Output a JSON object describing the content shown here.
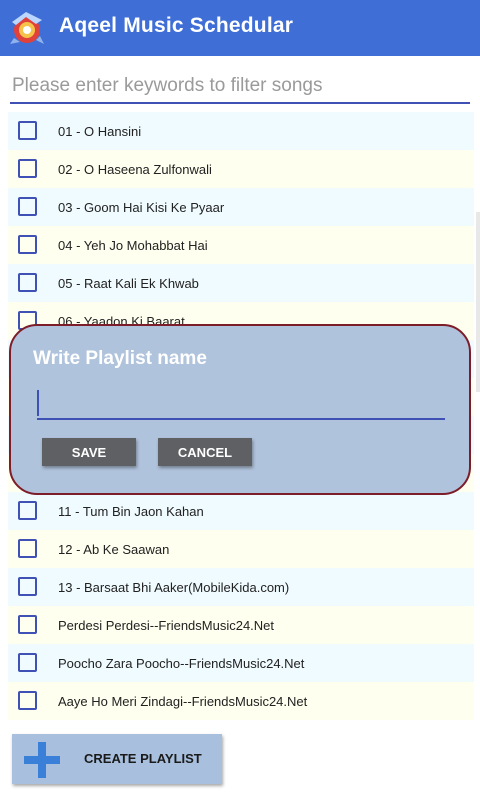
{
  "appbar": {
    "title": "Aqeel Music Schedular",
    "logo_icon": "music-note-logo-icon",
    "color": "#3f6fd6"
  },
  "search": {
    "placeholder": "Please enter keywords to filter songs",
    "value": ""
  },
  "songs": [
    {
      "label": "01 - O Hansini",
      "checked": false
    },
    {
      "label": "02 - O Haseena Zulfonwali",
      "checked": false
    },
    {
      "label": "03 - Goom Hai Kisi Ke Pyaar",
      "checked": false
    },
    {
      "label": "04 - Yeh Jo Mohabbat Hai",
      "checked": false
    },
    {
      "label": "05 - Raat Kali Ek Khwab",
      "checked": false
    },
    {
      "label": "06 - Yaadon Ki Baarat",
      "checked": false
    },
    {
      "label": "",
      "checked": false
    },
    {
      "label": "",
      "checked": false
    },
    {
      "label": "",
      "checked": false
    },
    {
      "label": "",
      "checked": false
    },
    {
      "label": "11 - Tum Bin Jaon Kahan",
      "checked": false
    },
    {
      "label": "12 - Ab Ke Saawan",
      "checked": false
    },
    {
      "label": "13 - Barsaat Bhi Aaker(MobileKida.com)",
      "checked": false
    },
    {
      "label": "Perdesi Perdesi--FriendsMusic24.Net",
      "checked": false
    },
    {
      "label": "Poocho Zara Poocho--FriendsMusic24.Net",
      "checked": false
    },
    {
      "label": "Aaye Ho Meri Zindagi--FriendsMusic24.Net",
      "checked": false
    }
  ],
  "dialog": {
    "title": "Write Playlist name",
    "input_value": "",
    "save_label": "SAVE",
    "cancel_label": "CANCEL"
  },
  "footer": {
    "create_label": "CREATE PLAYLIST",
    "icon": "plus-icon"
  }
}
